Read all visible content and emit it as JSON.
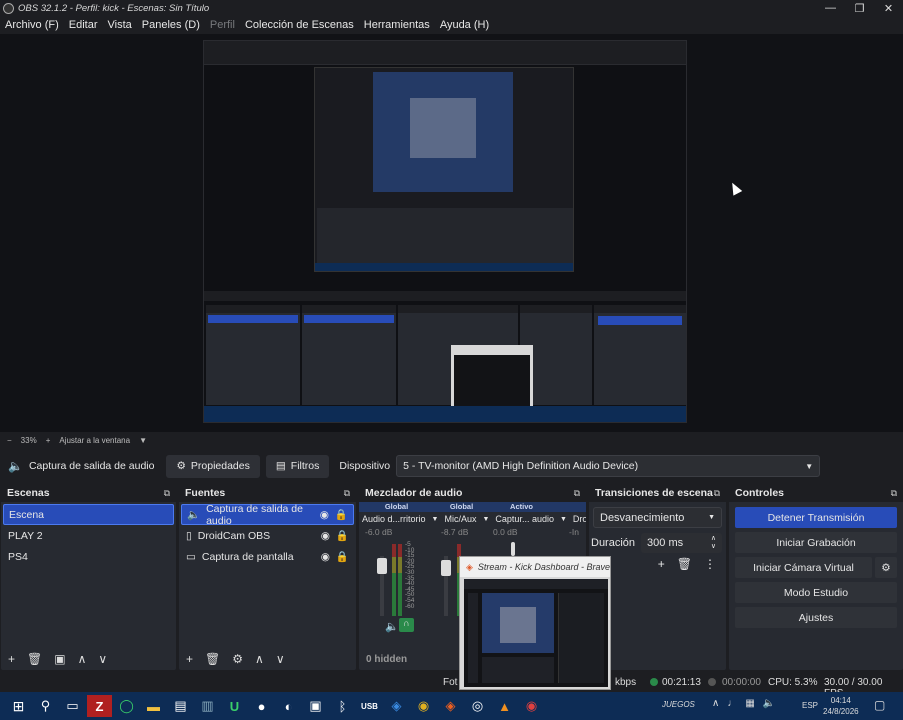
{
  "window": {
    "title": "OBS 32.1.2 - Perfil: kick - Escenas: Sin Título"
  },
  "menu": [
    "Archivo (F)",
    "Editar",
    "Vista",
    "Paneles (D)",
    "Perfil",
    "Colección de Escenas",
    "Herramientas",
    "Ayuda (H)"
  ],
  "zoom": {
    "minus": "−",
    "value": "33%",
    "plus": "+",
    "fit": "Ajustar a la ventana"
  },
  "context": {
    "source_name": "Captura de salida de audio",
    "properties": "Propiedades",
    "filters": "Filtros",
    "device_label": "Dispositivo",
    "device_value": "5 - TV-monitor (AMD High Definition Audio Device)"
  },
  "scenes": {
    "title": "Escenas",
    "items": [
      "Escena",
      "PLAY 2",
      "PS4"
    ]
  },
  "sources": {
    "title": "Fuentes",
    "items": [
      "Captura de salida de audio",
      "DroidCam OBS",
      "Captura de pantalla"
    ]
  },
  "mixer": {
    "title": "Mezclador de audio",
    "tabs": [
      "Global",
      "Global",
      "Activo"
    ],
    "channels": [
      {
        "name": "Audio d...rritorio",
        "db": "-6.0 dB"
      },
      {
        "name": "Mic/Aux",
        "db": "-8.7 dB"
      },
      {
        "name": "Captur... audio",
        "db": "0.0 dB"
      },
      {
        "name": "Dro",
        "db": "-In"
      }
    ],
    "scale": [
      "-5",
      "-10",
      "-15",
      "-20",
      "-25",
      "-30",
      "-35",
      "-40",
      "-45",
      "-50",
      "-54",
      "-60"
    ],
    "hidden": "0 hidden"
  },
  "transitions": {
    "title": "Transiciones de escena",
    "selected": "Desvanecimiento",
    "duration_label": "Duración",
    "duration_value": "300 ms"
  },
  "controls": {
    "title": "Controles",
    "buttons": [
      "Detener Transmisión",
      "Iniciar Grabación",
      "Iniciar Cámara Virtual",
      "Modo Estudio",
      "Ajustes"
    ]
  },
  "floating": {
    "title": "Stream - Kick Dashboard - Brave"
  },
  "status": {
    "frames": "Fot",
    "kbps": "kbps",
    "stream_time": "00:21:13",
    "rec_time": "00:00:00",
    "cpu": "CPU: 5.3%",
    "fps": "30.00 / 30.00 FPS"
  },
  "taskbar": {
    "juegos": "JUEGOS",
    "lang": "ESP",
    "time": "04:14",
    "date": "24/8/2026"
  },
  "colors": {
    "accent": "#284cb8",
    "panel": "#272a31",
    "taskbar": "#0d2c55"
  }
}
